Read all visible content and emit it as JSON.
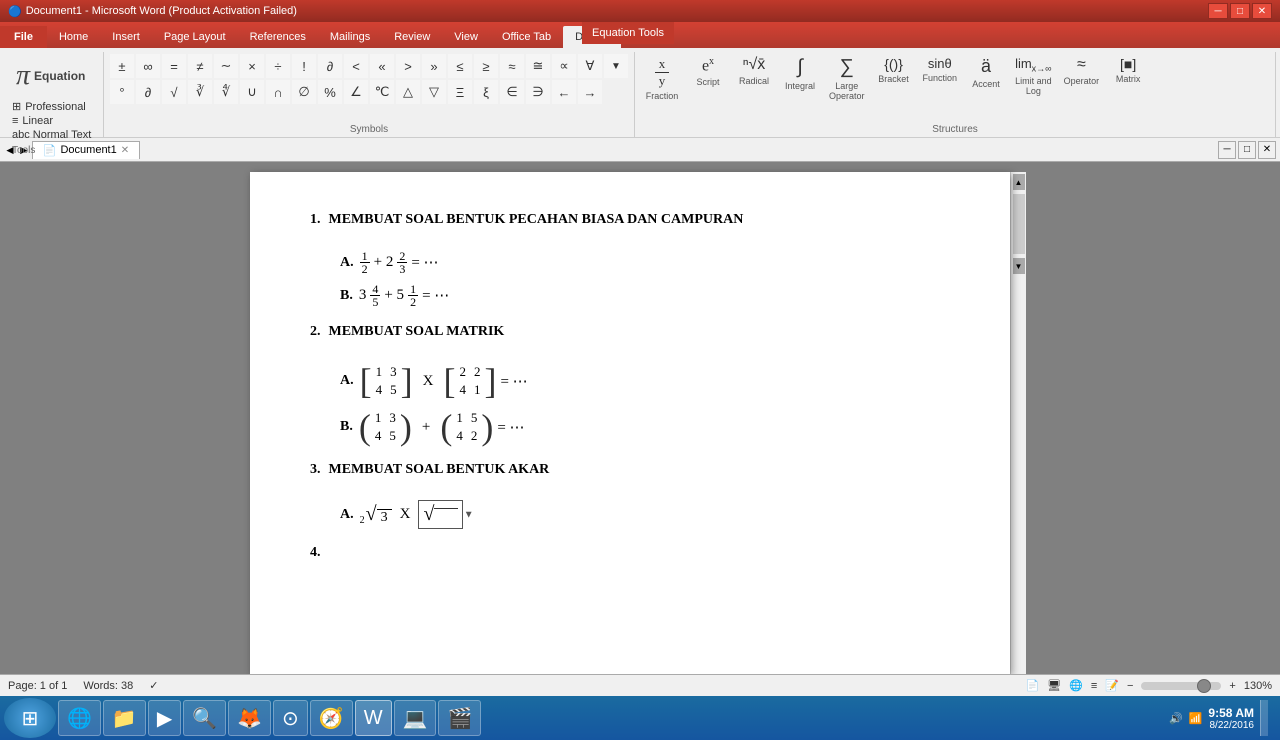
{
  "titlebar": {
    "title": "Document1 - Microsoft Word (Product Activation Failed)",
    "eq_tools": "Equation Tools"
  },
  "tabs": {
    "items": [
      "File",
      "Home",
      "Insert",
      "Page Layout",
      "References",
      "Mailings",
      "Review",
      "View",
      "Office Tab",
      "Design"
    ],
    "active": "Design",
    "doc_tab": "Document1"
  },
  "ribbon": {
    "tools_group": "Tools",
    "equation_label": "Equation",
    "format": {
      "professional": "Professional",
      "linear": "Linear",
      "normal_text": "abc Normal Text"
    },
    "symbols_group": "Symbols",
    "structures_group": "Structures",
    "structures": [
      {
        "label": "Fraction",
        "icon": "⁽ˣ⁾"
      },
      {
        "label": "Script",
        "icon": "eˣ"
      },
      {
        "label": "Radical",
        "icon": "√"
      },
      {
        "label": "Integral",
        "icon": "∫"
      },
      {
        "label": "Large Operator",
        "icon": "∑"
      },
      {
        "label": "Bracket",
        "icon": "{()}"
      },
      {
        "label": "Function",
        "icon": "sin"
      },
      {
        "label": "Accent",
        "icon": "ä"
      },
      {
        "label": "Limit and Log",
        "icon": "lim"
      },
      {
        "label": "Operator",
        "icon": "≈"
      },
      {
        "label": "Matrix",
        "icon": "[]"
      }
    ]
  },
  "document": {
    "content": {
      "sections": [
        {
          "number": "1.",
          "title": "MEMBUAT SOAL BENTUK PECAHAN BIASA DAN CAMPURAN",
          "items": [
            {
              "label": "A.",
              "math_display": "fraction_a"
            },
            {
              "label": "B.",
              "math_display": "fraction_b"
            }
          ]
        },
        {
          "number": "2.",
          "title": "MEMBUAT SOAL MATRIK",
          "items": [
            {
              "label": "A.",
              "math_display": "matrix_a"
            },
            {
              "label": "B.",
              "math_display": "matrix_b"
            }
          ]
        },
        {
          "number": "3.",
          "title": "MEMBUAT SOAL BENTUK AKAR",
          "items": [
            {
              "label": "A.",
              "math_display": "radical_a"
            }
          ]
        },
        {
          "number": "4.",
          "title": "",
          "items": []
        }
      ]
    }
  },
  "statusbar": {
    "page": "Page: 1 of 1",
    "words": "Words: 38",
    "zoom": "130%",
    "date": "8/22/2016",
    "time": "9:58 AM"
  }
}
